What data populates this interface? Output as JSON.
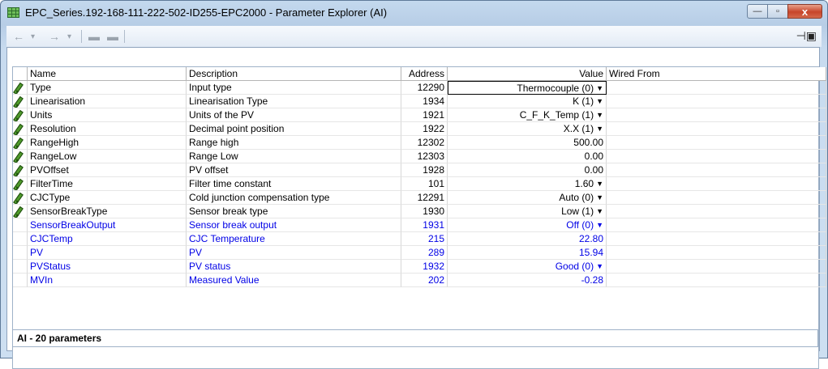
{
  "window": {
    "title": "EPC_Series.192-168-111-222-502-ID255-EPC2000 - Parameter Explorer (AI)",
    "minimize": "—",
    "maximize": "▫",
    "close": "x"
  },
  "toolbar": {
    "back": "←",
    "back_dd": "▾",
    "forward": "→",
    "forward_dd": "▾",
    "folder1": "▬",
    "folder2": "▬",
    "pin": "⊣▣"
  },
  "columns": [
    "Name",
    "Description",
    "Address",
    "Value",
    "Wired From"
  ],
  "rows": [
    {
      "name": "Type",
      "description": "Input type",
      "address": "12290",
      "value": "Thermocouple (0)",
      "dropdown": true,
      "editable": true,
      "readonly": false,
      "selected": true
    },
    {
      "name": "Linearisation",
      "description": "Linearisation Type",
      "address": "1934",
      "value": "K (1)",
      "dropdown": true,
      "editable": true,
      "readonly": false
    },
    {
      "name": "Units",
      "description": "Units of the PV",
      "address": "1921",
      "value": "C_F_K_Temp (1)",
      "dropdown": true,
      "editable": true,
      "readonly": false
    },
    {
      "name": "Resolution",
      "description": "Decimal point position",
      "address": "1922",
      "value": "X.X (1)",
      "dropdown": true,
      "editable": true,
      "readonly": false
    },
    {
      "name": "RangeHigh",
      "description": "Range high",
      "address": "12302",
      "value": "500.00",
      "dropdown": false,
      "editable": true,
      "readonly": false
    },
    {
      "name": "RangeLow",
      "description": "Range Low",
      "address": "12303",
      "value": "0.00",
      "dropdown": false,
      "editable": true,
      "readonly": false
    },
    {
      "name": "PVOffset",
      "description": "PV offset",
      "address": "1928",
      "value": "0.00",
      "dropdown": false,
      "editable": true,
      "readonly": false
    },
    {
      "name": "FilterTime",
      "description": "Filter time constant",
      "address": "101",
      "value": "1.60",
      "dropdown": true,
      "editable": true,
      "readonly": false
    },
    {
      "name": "CJCType",
      "description": "Cold junction compensation type",
      "address": "12291",
      "value": "Auto (0)",
      "dropdown": true,
      "editable": true,
      "readonly": false
    },
    {
      "name": "SensorBreakType",
      "description": "Sensor break type",
      "address": "1930",
      "value": "Low (1)",
      "dropdown": true,
      "editable": true,
      "readonly": false
    },
    {
      "name": "SensorBreakOutput",
      "description": "Sensor break output",
      "address": "1931",
      "value": "Off (0)",
      "dropdown": true,
      "editable": false,
      "readonly": true
    },
    {
      "name": "CJCTemp",
      "description": "CJC Temperature",
      "address": "215",
      "value": "22.80",
      "dropdown": false,
      "editable": false,
      "readonly": true
    },
    {
      "name": "PV",
      "description": "PV",
      "address": "289",
      "value": "15.94",
      "dropdown": false,
      "editable": false,
      "readonly": true
    },
    {
      "name": "PVStatus",
      "description": "PV status",
      "address": "1932",
      "value": "Good (0)",
      "dropdown": true,
      "editable": false,
      "readonly": true
    },
    {
      "name": "MVIn",
      "description": "Measured Value",
      "address": "202",
      "value": "-0.28",
      "dropdown": false,
      "editable": false,
      "readonly": true
    }
  ],
  "status": "AI  -  20 parameters",
  "colors": {
    "readonly_text": "#0000e6",
    "editable_icon": "#4f9a2b"
  }
}
